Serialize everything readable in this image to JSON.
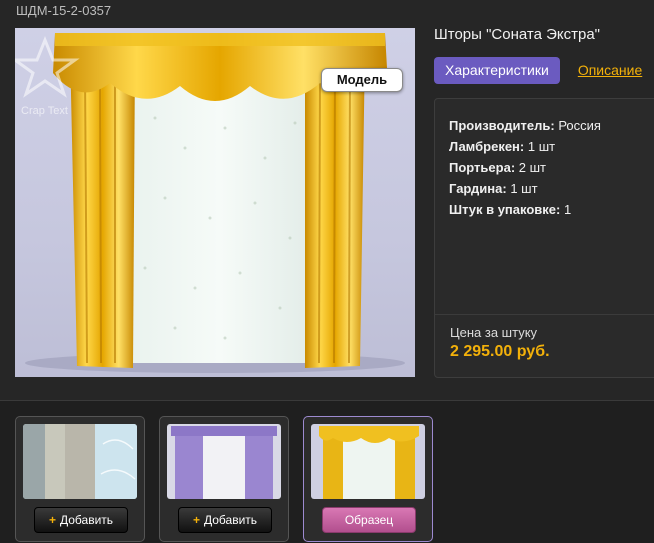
{
  "sku": "ШДМ-15-2-0357",
  "product": {
    "title": "Шторы \"Соната Экстра\"",
    "model_badge": "Модель",
    "watermark": "Crap Text"
  },
  "tabs": [
    {
      "label": "Характеристики",
      "active": true
    },
    {
      "label": "Описание",
      "active": false
    }
  ],
  "specs": [
    {
      "key": "Производитель:",
      "value": "Россия"
    },
    {
      "key": "Ламбрекен:",
      "value": "1 шт"
    },
    {
      "key": "Портьера:",
      "value": "2 шт"
    },
    {
      "key": "Гардина:",
      "value": "1 шт"
    },
    {
      "key": "Штук в упаковке:",
      "value": "1"
    }
  ],
  "price": {
    "label": "Цена за штуку",
    "value": "2 295.00 руб."
  },
  "thumbnails": [
    {
      "button": "Добавить",
      "plus": "+"
    },
    {
      "button": "Добавить",
      "plus": "+"
    },
    {
      "button": "Образец"
    }
  ],
  "colors": {
    "accent": "#f3b10a",
    "tab_active": "#6b5bc0",
    "sample_button": "#c9629f",
    "background": "#262626"
  }
}
